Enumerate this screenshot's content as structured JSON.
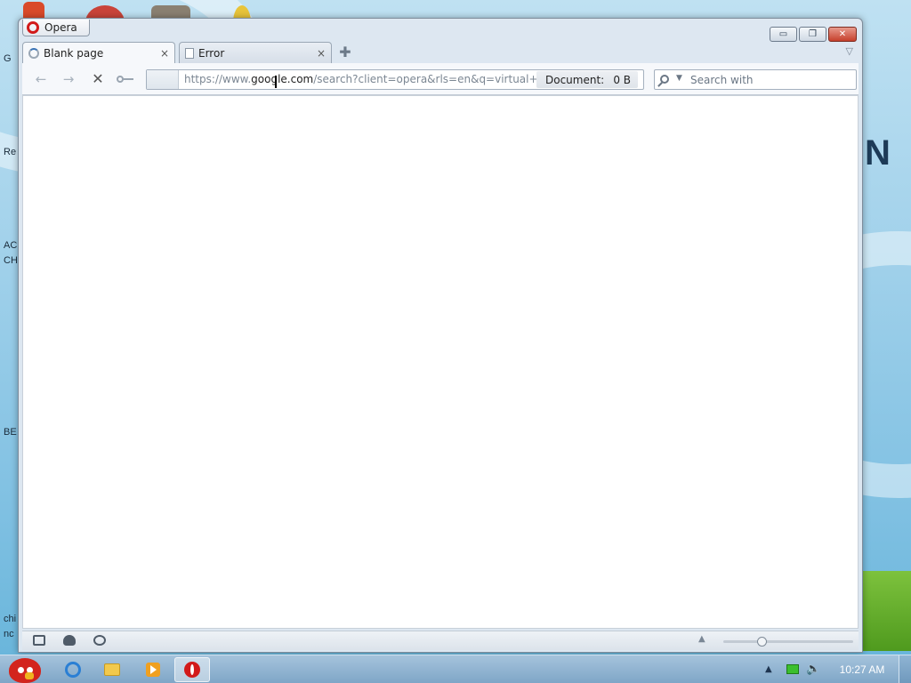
{
  "window": {
    "menu_label": "Opera",
    "controls": {
      "minimize": "▭",
      "restore": "❐",
      "close": "✕"
    }
  },
  "tabs": [
    {
      "label": "Blank page",
      "active": true,
      "icon": "loading-spinner-icon"
    },
    {
      "label": "Error",
      "active": false,
      "icon": "page-icon"
    }
  ],
  "tab_close_glyph": "×",
  "new_tab_glyph": "✚",
  "tab_menu_glyph": "▽",
  "toolbar": {
    "back": "←",
    "forward": "→",
    "stop": "✕",
    "address": {
      "prefix": "https://www.",
      "domain": "google.com",
      "suffix": "/search?client=opera&rls=en&q=virtual+box"
    },
    "document_label": "Document:",
    "document_size": "0 B",
    "search_placeholder": "Search with"
  },
  "statusbar": {
    "zoom_level_fraction": 0.28
  },
  "desktop": {
    "labels": [
      "G",
      "Re",
      "AC",
      "CH",
      "BE",
      "chi",
      "nc"
    ],
    "overlay_letter": "N"
  },
  "taskbar": {
    "clock": "10:27 AM",
    "apps": [
      "internet-explorer-icon",
      "folder-icon",
      "media-player-icon",
      "opera-icon"
    ]
  },
  "colors": {
    "opera_red": "#d21a1a",
    "close_button": "#c6402c",
    "taskbar": "#7fa6c7"
  }
}
